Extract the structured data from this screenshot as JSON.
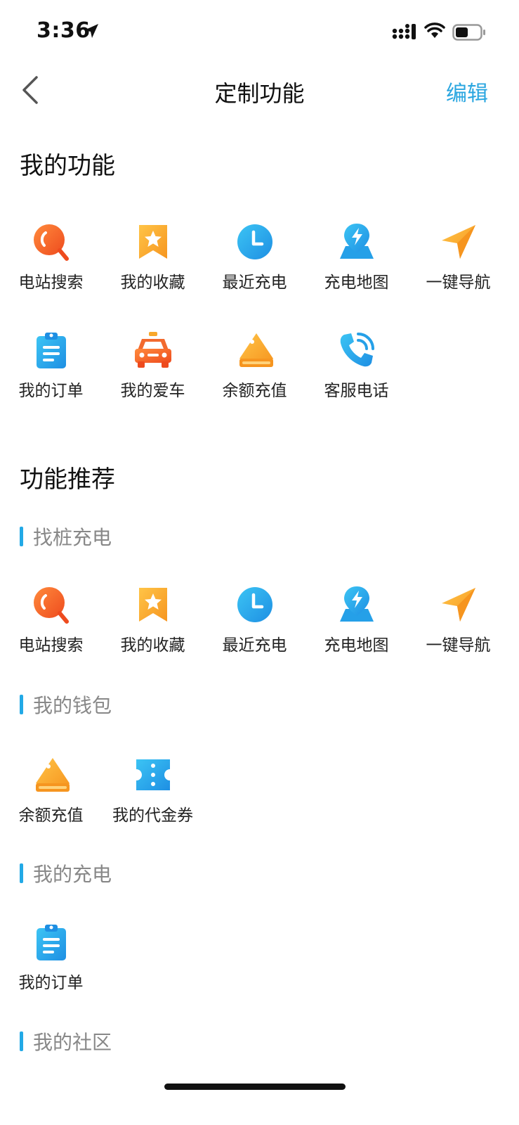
{
  "status": {
    "time": "3:36"
  },
  "nav": {
    "title": "定制功能",
    "edit": "编辑"
  },
  "my_functions": {
    "title": "我的功能",
    "row1": [
      {
        "label": "电站搜索",
        "icon": "search-icon"
      },
      {
        "label": "我的收藏",
        "icon": "star-bookmark-icon"
      },
      {
        "label": "最近充电",
        "icon": "clock-icon"
      },
      {
        "label": "充电地图",
        "icon": "map-pin-bolt-icon"
      },
      {
        "label": "一键导航",
        "icon": "navigation-arrow-icon"
      }
    ],
    "row2": [
      {
        "label": "我的订单",
        "icon": "clipboard-icon"
      },
      {
        "label": "我的爱车",
        "icon": "car-icon"
      },
      {
        "label": "余额充值",
        "icon": "card-recharge-icon"
      },
      {
        "label": "客服电话",
        "icon": "phone-icon"
      }
    ]
  },
  "recommended": {
    "title": "功能推荐",
    "groups": [
      {
        "title": "找桩充电",
        "items": [
          {
            "label": "电站搜索",
            "icon": "search-icon"
          },
          {
            "label": "我的收藏",
            "icon": "star-bookmark-icon"
          },
          {
            "label": "最近充电",
            "icon": "clock-icon"
          },
          {
            "label": "充电地图",
            "icon": "map-pin-bolt-icon"
          },
          {
            "label": "一键导航",
            "icon": "navigation-arrow-icon"
          }
        ]
      },
      {
        "title": "我的钱包",
        "items": [
          {
            "label": "余额充值",
            "icon": "card-recharge-icon"
          },
          {
            "label": "我的代金券",
            "icon": "voucher-icon"
          }
        ]
      },
      {
        "title": "我的充电",
        "items": [
          {
            "label": "我的订单",
            "icon": "clipboard-icon"
          }
        ]
      },
      {
        "title": "我的社区",
        "items": []
      }
    ]
  },
  "colors": {
    "accent": "#2aa6e0",
    "orange": "#f26a2e",
    "amber": "#f8a72a",
    "blue": "#25a0e8"
  }
}
